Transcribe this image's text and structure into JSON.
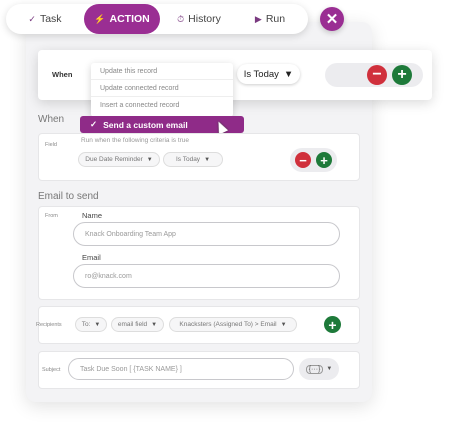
{
  "tabs": [
    {
      "icon": "✓",
      "label": "Task"
    },
    {
      "icon": "⚡",
      "label": "ACTION"
    },
    {
      "icon": "⏱",
      "label": "History"
    },
    {
      "icon": "▶",
      "label": "Run"
    }
  ],
  "close_icon": "✕",
  "when_row": {
    "label": "When",
    "operator": "Is Today",
    "caret": "▼"
  },
  "dropdown": {
    "items": [
      "Update this record",
      "Update connected record",
      "Insert a connected record"
    ],
    "selected": "Send a custom email",
    "check": "✓"
  },
  "when_section": {
    "title": "When",
    "field_label": "Field",
    "hint": "Run when the following criteria is true",
    "field_chip": "Due Date Reminder",
    "operator_chip": "Is Today"
  },
  "email_section": {
    "title": "Email to send",
    "from_label": "From",
    "name_label": "Name",
    "name_value": "Knack Onboarding Team App",
    "email_label": "Email",
    "email_value": "ro@knack.com",
    "recipients_label": "Recipients",
    "to_chip": "To:",
    "type_chip": "email field",
    "field_chip": "Knacksters (Assigned To) > Email",
    "subject_label": "Subject",
    "subject_value": "Task Due Soon [ {TASK NAME} ]",
    "insert_icon": "{···}"
  },
  "symbols": {
    "minus": "−",
    "plus": "+",
    "caret": "▼"
  },
  "colors": {
    "accent": "#9a2e93",
    "danger": "#d0303c",
    "success": "#1e7a3a"
  }
}
